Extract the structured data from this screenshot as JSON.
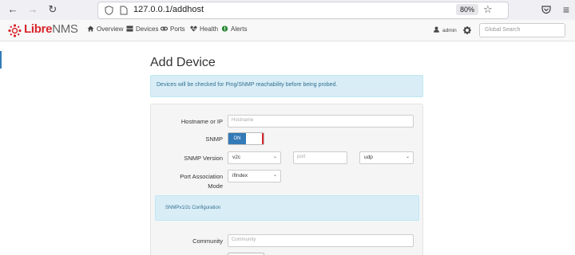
{
  "browser": {
    "url": "127.0.0.1/addhost",
    "zoom": "80%"
  },
  "navbar": {
    "logo": {
      "part1": "Libre",
      "part2": "NMS"
    },
    "menu": [
      {
        "label": "Overview",
        "icon": "home-icon"
      },
      {
        "label": "Devices",
        "icon": "server-icon"
      },
      {
        "label": "Ports",
        "icon": "link-icon"
      },
      {
        "label": "Health",
        "icon": "heartbeat-icon"
      },
      {
        "label": "Alerts",
        "icon": "alert-circle-icon"
      }
    ],
    "user": "admin",
    "search_placeholder": "Global Search"
  },
  "page": {
    "title": "Add Device",
    "info": "Devices will be checked for Ping/SNMP reachability before being probed."
  },
  "form": {
    "hostname_label": "Hostname or IP",
    "hostname_placeholder": "Hostname",
    "snmp_label": "SNMP",
    "snmp_toggle": "ON",
    "snmp_version_label": "SNMP Version",
    "snmp_version": "v2c",
    "port_placeholder": "port",
    "transport": "udp",
    "port_assoc_label1": "Port Association",
    "port_assoc_label2": "Mode",
    "port_assoc_value": "ifIndex",
    "snmp_config_title": "SNMPv1/2c Configuration",
    "community_label": "Community",
    "community_placeholder": "Community"
  },
  "colors": {
    "accent": "#337ab7",
    "brand": "#d9262c",
    "info_bg": "#d9edf7"
  }
}
